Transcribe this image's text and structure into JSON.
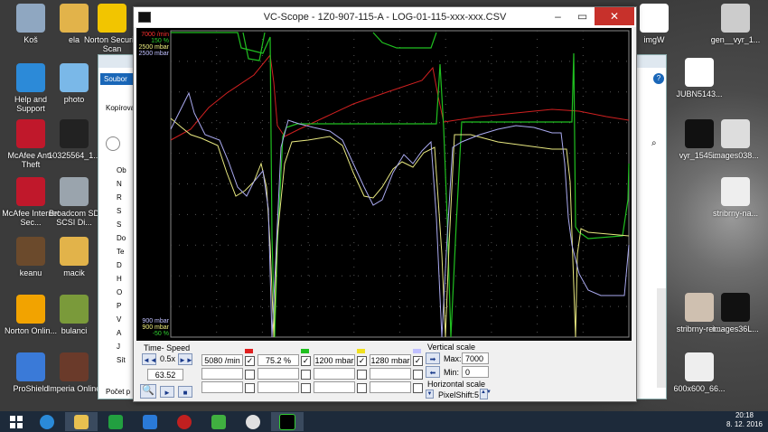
{
  "desktop_left": [
    {
      "label": "Koš",
      "color": "#8fa7c1"
    },
    {
      "label": "ela",
      "color": "#e2b34a"
    },
    {
      "label": "Norton Security Scan",
      "color": "#f2c500"
    },
    {
      "label": "Help and Support",
      "color": "#2c8ad8"
    },
    {
      "label": "photo",
      "color": "#7ab8e8"
    },
    {
      "label": "McAfee Anti-Theft",
      "color": "#c0182b"
    },
    {
      "label": "10325564_1...",
      "color": "#222222"
    },
    {
      "label": "McAfee Internet Sec...",
      "color": "#c0182b"
    },
    {
      "label": "Broadcom SD SCSI Di...",
      "color": "#9aa4ad"
    },
    {
      "label": "keanu",
      "color": "#6b4a2c"
    },
    {
      "label": "macik",
      "color": "#e2b34a"
    },
    {
      "label": "Norton Onlin...",
      "color": "#f2a300"
    },
    {
      "label": "bulanci",
      "color": "#7a9a3a"
    },
    {
      "label": "ProShield",
      "color": "#3a7ad8"
    },
    {
      "label": "Imperia Online",
      "color": "#6a3a2a"
    }
  ],
  "desktop_right": [
    {
      "label": "imgW",
      "color": "#ffffff"
    },
    {
      "label": "gen__vyr_1...",
      "color": "#cccccc"
    },
    {
      "label": "JUBN5143...",
      "color": "#ffffff"
    },
    {
      "label": "vyr_1545...",
      "color": "#111111"
    },
    {
      "label": "images038...",
      "color": "#dddddd"
    },
    {
      "label": "stribrny-na...",
      "color": "#eeeeee"
    },
    {
      "label": "stribrny-ret...",
      "color": "#cfc0b0"
    },
    {
      "label": "images36L...",
      "color": "#111111"
    },
    {
      "label": "600x600_66...",
      "color": "#eeeeee"
    }
  ],
  "explorer": {
    "ribbon_tab": "Soubor",
    "toolbar_label": "Kopírovat",
    "status": "Počet p",
    "sidebar": [
      "Ob",
      "N",
      "R",
      "S",
      "S",
      "Do",
      "Te",
      "D",
      "H",
      "O",
      "P",
      "V",
      "A",
      "J",
      "Sít"
    ]
  },
  "scope": {
    "title": "VC-Scope   -   1Z0-907-115-A   -   LOG-01-115-xxx-xxx.CSV",
    "top_labels": [
      {
        "text": "7000 /min",
        "color": "#ff3030"
      },
      {
        "text": "150 %",
        "color": "#30d030"
      },
      {
        "text": "2500 mbar",
        "color": "#f0f080"
      },
      {
        "text": "2500 mbar",
        "color": "#c0c0ff"
      }
    ],
    "bottom_labels": [
      {
        "text": "900 mbar",
        "color": "#c0c0ff"
      },
      {
        "text": "900 mbar",
        "color": "#f0f080"
      },
      {
        "text": "-50 %",
        "color": "#30d030"
      }
    ],
    "colors": {
      "rpm": "#d02020",
      "pct": "#20c020",
      "yel": "#e8e880",
      "blu": "#aaaaf0"
    }
  },
  "controls": {
    "time_speed": "Time- Speed",
    "speed": "0.5x",
    "time": "63.52",
    "rpm_value": "5080 /min",
    "pct_value": "75.2 %",
    "mbar1_value": "1200 mbar",
    "mbar2_value": "1280 mbar",
    "vertical_scale": "Vertical scale",
    "max_label": "Max:",
    "max_value": "7000",
    "min_label": "Min:",
    "min_value": "0",
    "horizontal_scale": "Horizontal scale",
    "pixelshift": "PixelShift:5",
    "swatch_colors": [
      "#e02020",
      "#20c020",
      "#f0e020",
      "#c0c0ff"
    ]
  },
  "tray": {
    "time": "20:18",
    "date": "8. 12. 2016"
  }
}
